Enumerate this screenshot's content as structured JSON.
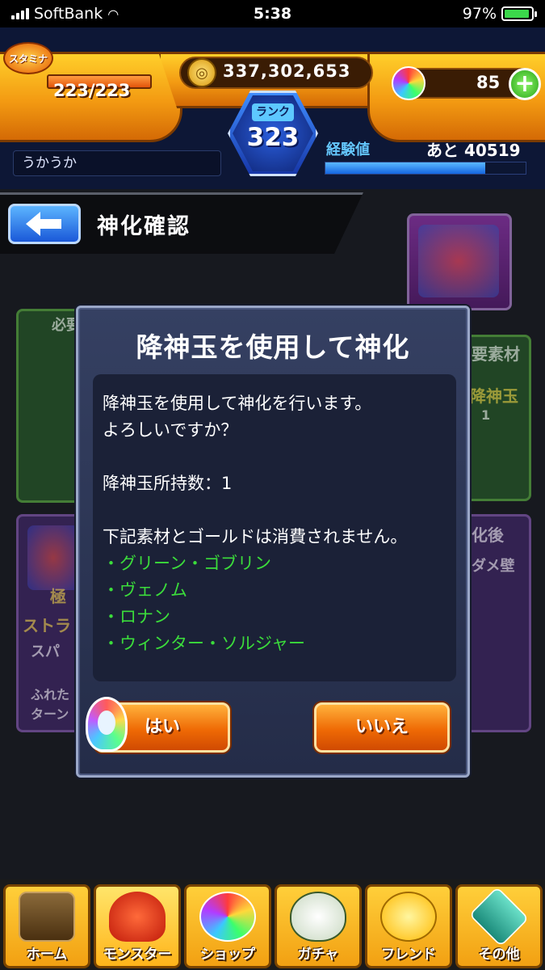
{
  "status_bar": {
    "carrier": "SoftBank",
    "time": "5:38",
    "battery": "97%"
  },
  "header": {
    "stamina_label": "スタミナ",
    "stamina_value": "223/223",
    "gold": "337,302,653",
    "orbs": "85",
    "rank_label": "ランク",
    "rank_value": "323",
    "player_name": "うかうか",
    "exp_label": "経験値",
    "exp_remaining": "あと 40519",
    "exp_progress": 0.8
  },
  "page": {
    "title": "神化確認"
  },
  "background": {
    "label_required": "必要",
    "label_materials": "要素材",
    "label_jinshindama": "降神玉",
    "label_count": "1",
    "label_after": "化後",
    "label_wall": "ダメ壁",
    "label_kiwami": "極",
    "label_stra": "ストラ",
    "label_spa": "スパ",
    "label_fureta": "ふれた",
    "label_turn": "ターン"
  },
  "dialog": {
    "title": "降神玉を使用して神化",
    "line1": "降神玉を使用して神化を行います。",
    "line2": "よろしいですか？",
    "line3": "降神玉所持数：1",
    "line4": "下記素材とゴールドは消費されません。",
    "materials": [
      "・グリーン・ゴブリン",
      "・ヴェノム",
      "・ロナン",
      "・ウィンター・ソルジャー"
    ],
    "yes": "はい",
    "no": "いいえ"
  },
  "nav": [
    "ホーム",
    "モンスター",
    "ショップ",
    "ガチャ",
    "フレンド",
    "その他"
  ]
}
